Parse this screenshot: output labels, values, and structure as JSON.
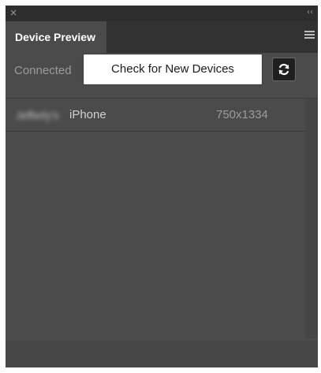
{
  "window": {
    "close_icon": "close-icon",
    "collapse_icon": "double-chevron-icon"
  },
  "tab": {
    "label": "Device Preview",
    "menu_icon": "hamburger-menu-icon"
  },
  "header": {
    "connected_label": "Connected",
    "check_button_label": "Check for New Devices",
    "refresh_icon": "refresh-icon"
  },
  "devices": [
    {
      "owner": "Jefferly's",
      "name": "iPhone",
      "resolution": "750x1334"
    }
  ],
  "colors": {
    "panel_bg": "#4b4b4b",
    "tab_bar_bg": "#323232",
    "button_bg": "#ffffff",
    "refresh_bg": "#1f1f1f"
  }
}
